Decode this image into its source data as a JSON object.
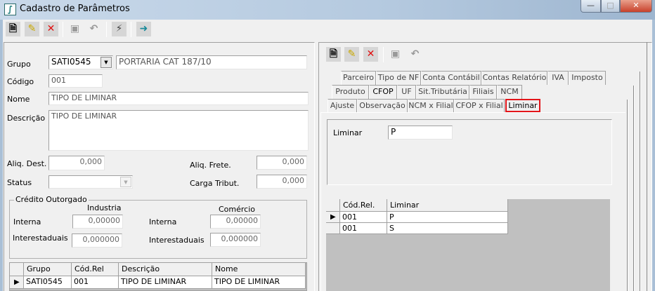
{
  "window": {
    "title": "Cadastro de Parâmetros",
    "minimize": "—",
    "maximize": "□",
    "close": "✕"
  },
  "toolbar": {
    "new": "new-document-icon",
    "edit": "edit-icon",
    "delete": "delete-icon",
    "save": "save-icon",
    "undo": "undo-icon",
    "filter": "filter-icon",
    "exit": "exit-icon"
  },
  "form": {
    "grupo_label": "Grupo",
    "grupo_value": "SATI0545",
    "grupo_desc": "PORTARIA CAT 187/10",
    "codigo_label": "Código",
    "codigo_value": "001",
    "nome_label": "Nome",
    "nome_value": "TIPO DE LIMINAR",
    "descricao_label": "Descrição",
    "descricao_value": "TIPO DE LIMINAR",
    "aliq_dest_label": "Aliq. Dest.",
    "aliq_dest_value": "0,000",
    "aliq_frete_label": "Aliq. Frete.",
    "aliq_frete_value": "0,000",
    "status_label": "Status",
    "status_value": "",
    "carga_label": "Carga Tribut.",
    "carga_value": "0,000"
  },
  "credito": {
    "legend": "Crédito Outorgado",
    "industria": "Industria",
    "comercio": "Comércio",
    "interna_label": "Interna",
    "interestaduais_label": "Interestaduais",
    "ind_interna": "0,00000",
    "ind_interest": "0,000000",
    "com_interna": "0,00000",
    "com_interest": "0,000000"
  },
  "main_grid": {
    "columns": [
      "Grupo",
      "Cód.Rel",
      "Descrição",
      "Nome"
    ],
    "rows": [
      [
        "SATI0545",
        "001",
        "TIPO DE LIMINAR",
        "TIPO DE LIMINAR"
      ]
    ]
  },
  "tabs": {
    "row1": [
      "Parceiro",
      "Tipo de NF",
      "Conta Contábil",
      "Contas Relatório",
      "IVA",
      "Imposto"
    ],
    "row2": [
      "Produto",
      "CFOP",
      "UF",
      "Sit.Tributária",
      "Filiais",
      "NCM"
    ],
    "row3": [
      "Ajuste",
      "Observação",
      "NCM x Filial",
      "CFOP x Filial",
      "Liminar"
    ]
  },
  "liminar": {
    "label": "Liminar",
    "value": "P",
    "columns": [
      "Cód.Rel.",
      "Liminar"
    ],
    "rows": [
      [
        "001",
        "P"
      ],
      [
        "001",
        "S"
      ]
    ]
  }
}
